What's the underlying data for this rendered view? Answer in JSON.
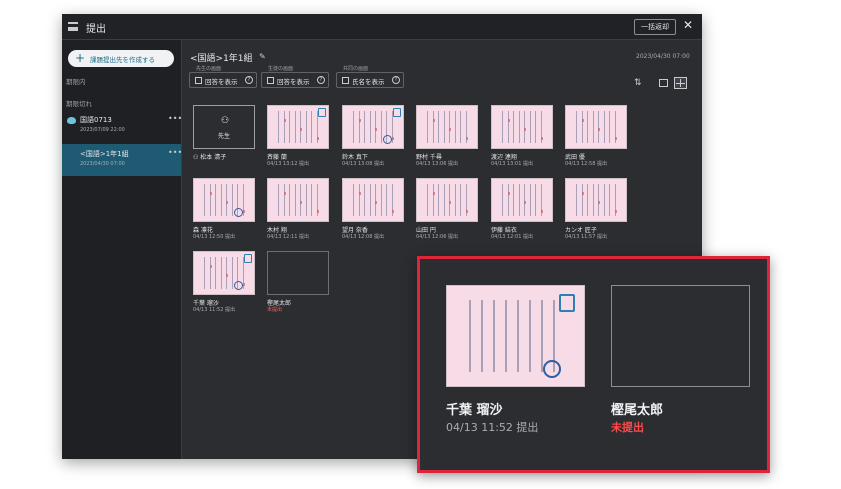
{
  "window": {
    "title": "提出",
    "bulk_button": "一括返却",
    "close_glyph": "✕"
  },
  "sidebar": {
    "create_button": "課題提出先を作成する",
    "section_in_progress": "期限内",
    "section_overdue": "期限切れ",
    "tasks": [
      {
        "name": "国語0713",
        "date": "2023/07/09 22:00"
      },
      {
        "name": "<国語>1年1組",
        "date": "2023/04/30 07:00"
      }
    ]
  },
  "main": {
    "title": "<国語>1年1組",
    "deadline": "2023/04/30 07:00",
    "controls": [
      {
        "caption": "先生の画面",
        "label": "回答を表示"
      },
      {
        "caption": "生徒の画面",
        "label": "回答を表示"
      },
      {
        "caption": "共同の画面",
        "label": "氏名を表示"
      }
    ],
    "teacher_card": {
      "label": "先生",
      "owner": "松本 清子"
    },
    "cards": [
      {
        "name": "斉藤 蘭",
        "time": "04/13 13:12 提出"
      },
      {
        "name": "鈴木 真下",
        "time": "04/13 13:08 提出"
      },
      {
        "name": "野村 千尋",
        "time": "04/13 13:06 提出"
      },
      {
        "name": "渡辺 連翔",
        "time": "04/13 13:01 提出"
      },
      {
        "name": "武田 優",
        "time": "04/13 12:58 提出"
      },
      {
        "name": "森 凛花",
        "time": "04/13 12:50 提出"
      },
      {
        "name": "木村 翔",
        "time": "04/13 12:11 提出"
      },
      {
        "name": "望月 奈香",
        "time": "04/13 12:08 提出"
      },
      {
        "name": "山田 円",
        "time": "04/13 12:06 提出"
      },
      {
        "name": "伊藤 結衣",
        "time": "04/13 12:01 提出"
      },
      {
        "name": "カンオ 匠子",
        "time": "04/13 11:57 提出"
      },
      {
        "name": "千葉 瑠沙",
        "time": "04/13 11:52 提出"
      },
      {
        "name": "樫尾太郎",
        "time": "未提出"
      }
    ]
  },
  "zoom": {
    "cards": [
      {
        "name": "千葉 瑠沙",
        "time": "04/13 11:52 提出"
      },
      {
        "name": "樫尾太郎",
        "time": "未提出"
      }
    ]
  },
  "colors": {
    "highlight_border": "#e0243a",
    "not_submitted": "#ff4a4a",
    "selected_task": "#1f5a73",
    "thumb_bg": "#f7dbe6"
  },
  "icons": [
    "menu-icon",
    "close-icon",
    "plus-icon",
    "cloud-icon",
    "more-icon",
    "pencil-icon",
    "user-icon",
    "help-icon",
    "sort-icon",
    "single-view-icon",
    "grid-view-icon",
    "check-badge-icon",
    "stamp-icon"
  ]
}
